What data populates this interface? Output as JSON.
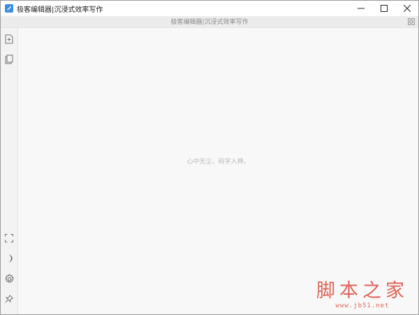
{
  "window": {
    "title": "极客编辑器|沉浸式效率写作",
    "controls": [
      "minimize-icon",
      "maximize-icon",
      "close-icon"
    ]
  },
  "header": {
    "document_title": "极客编辑器|沉浸式效率写作",
    "right_icon": "grid-icon"
  },
  "sidebar": {
    "top_tools": [
      {
        "icon": "new-file-icon"
      },
      {
        "icon": "copy-document-icon"
      }
    ],
    "bottom_tools": [
      {
        "icon": "fullscreen-icon"
      },
      {
        "icon": "night-mode-icon"
      },
      {
        "icon": "settings-icon"
      },
      {
        "icon": "pin-icon"
      }
    ]
  },
  "editor": {
    "placeholder": "心中无尘，码字入神。"
  },
  "watermark": {
    "site_name": "脚本之家",
    "site_url": "www.jb51.net"
  },
  "colors": {
    "accent": "#3b8ee0",
    "watermark": "#d94b3c"
  }
}
